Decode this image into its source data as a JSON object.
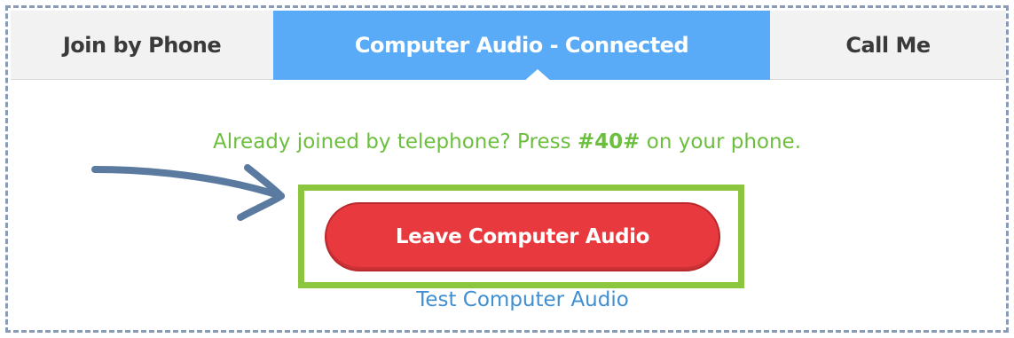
{
  "tabs": {
    "join_by_phone": "Join by Phone",
    "computer_audio": "Computer Audio - Connected",
    "call_me": "Call Me"
  },
  "hint": {
    "prefix": "Already joined by telephone? Press ",
    "code": "#40#",
    "suffix": " on your phone."
  },
  "actions": {
    "leave_label": "Leave Computer Audio",
    "test_label": "Test Computer Audio"
  },
  "annotation": {
    "arrow_icon": "hand-drawn-arrow-icon",
    "highlight": "green-highlight-box"
  },
  "colors": {
    "tab_active": "#5aabf7",
    "tab_inactive": "#f2f2f2",
    "hint_text": "#6cbf3e",
    "leave_button": "#e8393e",
    "link": "#3f8fd2",
    "highlight": "#8cc63f",
    "arrow": "#5b7aa0",
    "frame_border": "#8a9bb5"
  }
}
